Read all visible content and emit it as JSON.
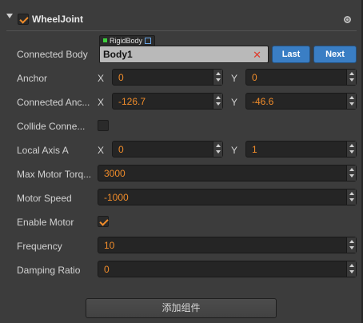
{
  "component": {
    "title": "WheelJoint",
    "enabled": true
  },
  "connected_body": {
    "label": "Connected Body",
    "type_tag": "RigidBody",
    "value": "Body1",
    "last_label": "Last",
    "next_label": "Next"
  },
  "anchor": {
    "label": "Anchor",
    "x_axis": "X",
    "y_axis": "Y",
    "x": "0",
    "y": "0"
  },
  "connected_anchor": {
    "label": "Connected Anc...",
    "x_axis": "X",
    "y_axis": "Y",
    "x": "-126.7",
    "y": "-46.6"
  },
  "collide_connected": {
    "label": "Collide Conne...",
    "checked": false
  },
  "local_axis_a": {
    "label": "Local Axis A",
    "x_axis": "X",
    "y_axis": "Y",
    "x": "0",
    "y": "1"
  },
  "max_motor_torque": {
    "label": "Max Motor Torq...",
    "value": "3000"
  },
  "motor_speed": {
    "label": "Motor Speed",
    "value": "-1000"
  },
  "enable_motor": {
    "label": "Enable Motor",
    "checked": true
  },
  "frequency": {
    "label": "Frequency",
    "value": "10"
  },
  "damping_ratio": {
    "label": "Damping Ratio",
    "value": "0"
  },
  "add_component_label": "添加组件",
  "colors": {
    "accent": "#f08c2a",
    "button_blue": "#3a7ec4",
    "panel_bg": "#3c3c3c",
    "field_bg": "#252525"
  }
}
